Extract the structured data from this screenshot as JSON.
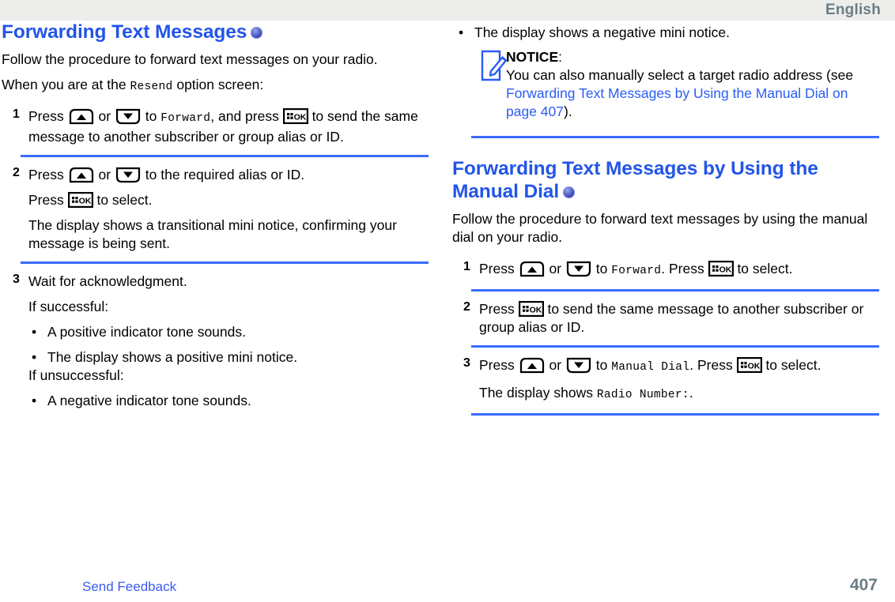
{
  "header": {
    "language": "English"
  },
  "footer": {
    "feedback_label": "Send Feedback",
    "page_number": "407"
  },
  "left": {
    "heading": "Forwarding Text Messages",
    "intro": "Follow the procedure to forward text messages on your radio.",
    "context_pre": "When you are at the ",
    "context_mono": "Resend",
    "context_post": " option screen:",
    "steps": [
      {
        "num": "1",
        "p1_a": "Press ",
        "p1_b": " or ",
        "p1_c": " to ",
        "p1_mono": "Forward",
        "p1_d": ", and press ",
        "p1_e": " to send the same message to another subscriber or group alias or ID."
      },
      {
        "num": "2",
        "p1_a": "Press ",
        "p1_b": " or ",
        "p1_c": " to the required alias or ID.",
        "p2_a": "Press ",
        "p2_b": " to select.",
        "p3": "The display shows a transitional mini notice, confirming your message is being sent."
      },
      {
        "num": "3",
        "p1": "Wait for acknowledgment.",
        "p2": "If successful:",
        "bullets_success": [
          "A positive indicator tone sounds.",
          "The display shows a positive mini notice."
        ],
        "p3": "If unsuccessful:",
        "bullets_fail": [
          "A negative indicator tone sounds."
        ]
      }
    ]
  },
  "right": {
    "top_bullet": "The display shows a negative mini notice.",
    "notice": {
      "title": "NOTICE",
      "colon": ":",
      "body_pre": "You can also manually select a target radio address (see ",
      "link": "Forwarding Text Messages by Using the Manual Dial on page 407",
      "body_post": ")."
    },
    "heading": "Forwarding Text Messages by Using the Manual Dial",
    "intro": "Follow the procedure to forward text messages by using the manual dial on your radio.",
    "steps": [
      {
        "num": "1",
        "p1_a": "Press ",
        "p1_b": " or ",
        "p1_c": " to ",
        "p1_mono": "Forward",
        "p1_d": ". Press ",
        "p1_e": " to select."
      },
      {
        "num": "2",
        "p1_a": "Press ",
        "p1_b": " to send the same message to another subscriber or group alias or ID."
      },
      {
        "num": "3",
        "p1_a": "Press ",
        "p1_b": " or ",
        "p1_c": " to ",
        "p1_mono": "Manual Dial",
        "p1_d": ". Press ",
        "p1_e": " to select.",
        "p2_a": "The display shows ",
        "p2_mono": "Radio Number:",
        "p2_b": "."
      }
    ]
  },
  "icons": {
    "up_key": "up-arrow-key-icon",
    "down_key": "down-arrow-key-icon",
    "ok_key": "menu-ok-key-icon",
    "radio_badge": "portable-radio-badge-icon",
    "notice": "notice-pencil-icon"
  },
  "colors": {
    "heading_blue": "#2255e8",
    "divider_blue": "#3a6bff",
    "link_blue": "#2a5df5",
    "header_gray": "#ededec",
    "header_text": "#6b7d85"
  }
}
